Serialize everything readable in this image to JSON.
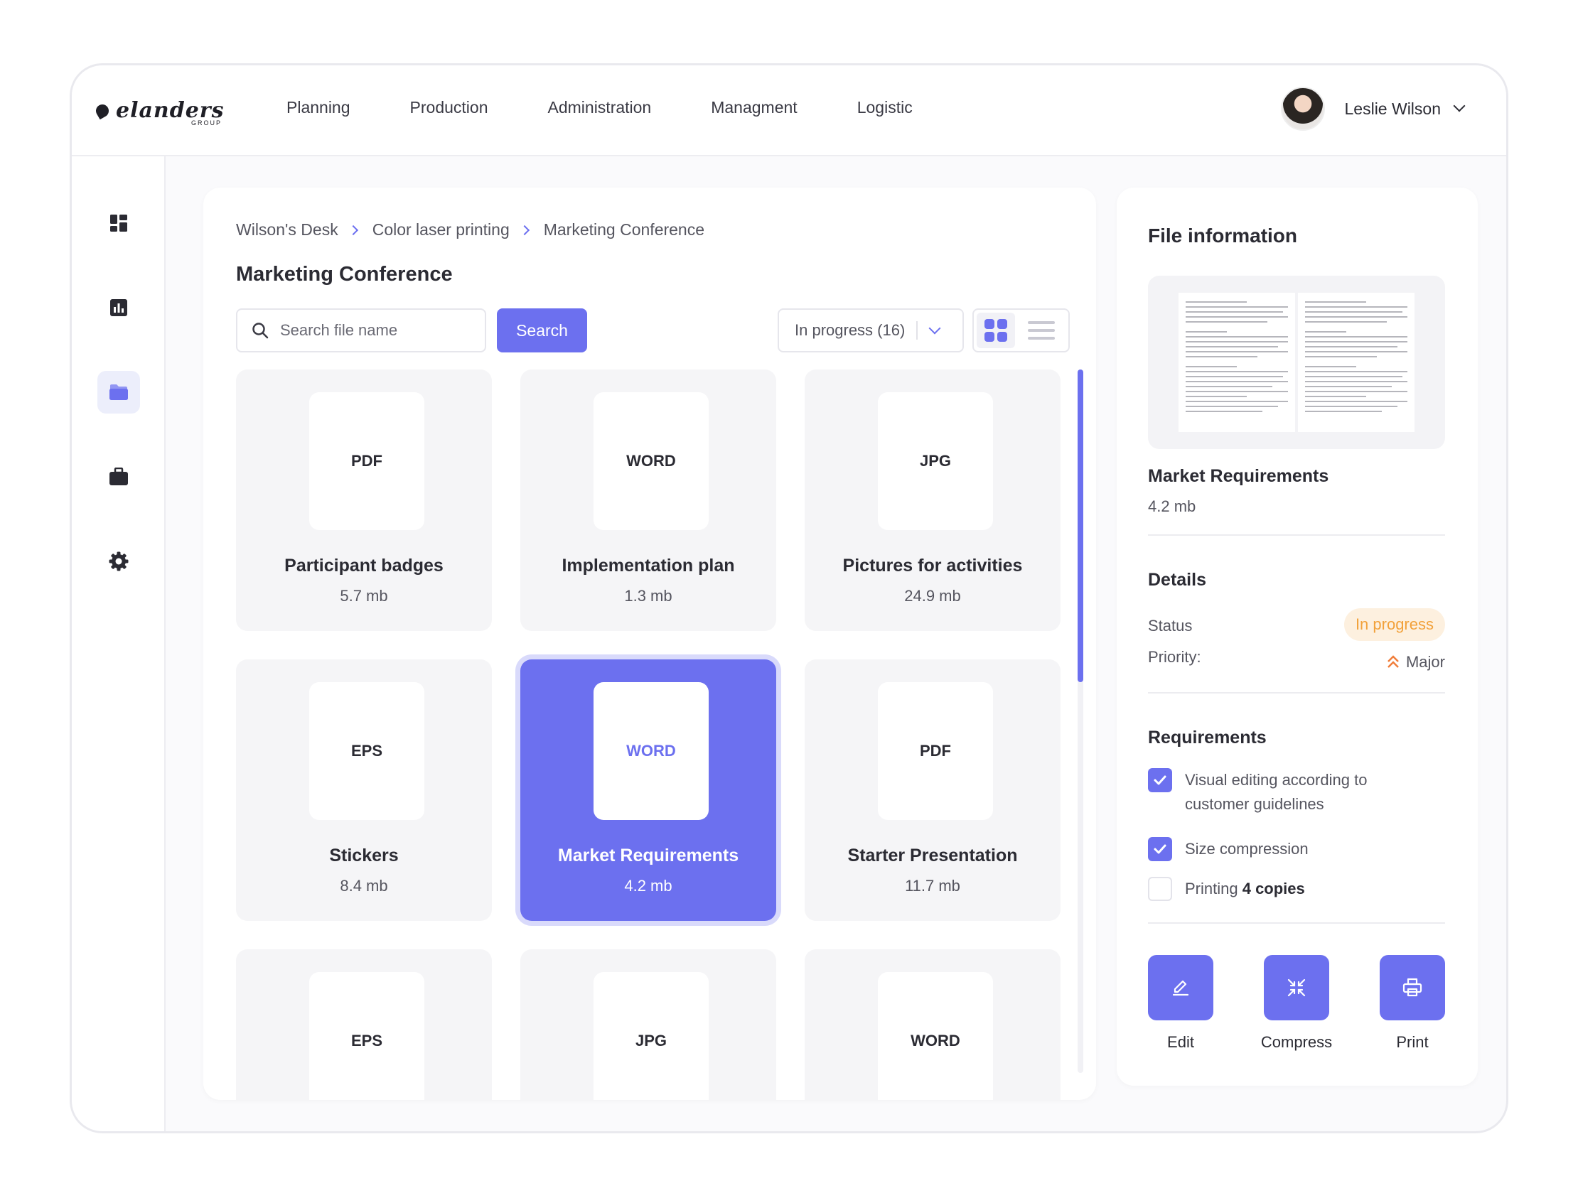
{
  "brand": {
    "name": "elanders",
    "sub": "GROUP"
  },
  "nav": [
    "Planning",
    "Production",
    "Administration",
    "Managment",
    "Logistic"
  ],
  "user": {
    "name": "Leslie Wilson"
  },
  "sidebar": {
    "icons": [
      "dashboard-icon",
      "chart-icon",
      "folder-icon",
      "briefcase-icon",
      "gear-icon"
    ],
    "active": "folder-icon"
  },
  "breadcrumb": [
    "Wilson's Desk",
    "Color laser printing",
    "Marketing Conference"
  ],
  "page_title": "Marketing Conference",
  "search": {
    "placeholder": "Search file name",
    "button": "Search"
  },
  "filter": {
    "label": "In progress (16)"
  },
  "files": [
    {
      "type": "PDF",
      "name": "Participant badges",
      "size": "5.7 mb"
    },
    {
      "type": "WORD",
      "name": "Implementation plan",
      "size": "1.3 mb"
    },
    {
      "type": "JPG",
      "name": "Pictures for activities",
      "size": "24.9 mb"
    },
    {
      "type": "EPS",
      "name": "Stickers",
      "size": "8.4 mb"
    },
    {
      "type": "WORD",
      "name": "Market Requirements",
      "size": "4.2 mb",
      "selected": true
    },
    {
      "type": "PDF",
      "name": "Starter Presentation",
      "size": "11.7 mb"
    },
    {
      "type": "EPS",
      "name": "",
      "size": ""
    },
    {
      "type": "JPG",
      "name": "",
      "size": ""
    },
    {
      "type": "WORD",
      "name": "",
      "size": ""
    }
  ],
  "info": {
    "title": "File information",
    "file_name": "Market Requirements",
    "file_size": "4.2 mb",
    "details_title": "Details",
    "status_label": "Status",
    "status_value": "In progress",
    "priority_label": "Priority:",
    "priority_value": "Major",
    "requirements_title": "Requirements",
    "req1": "Visual editing according to customer guidelines",
    "req2": "Size compression",
    "req3_prefix": "Printing ",
    "req3_bold": "4 copies",
    "actions": {
      "edit": "Edit",
      "compress": "Compress",
      "print": "Print"
    }
  },
  "colors": {
    "accent": "#6c70ef",
    "status": "#f2a13a",
    "status_bg": "#fdf0df",
    "priority": "#f07d3a"
  }
}
